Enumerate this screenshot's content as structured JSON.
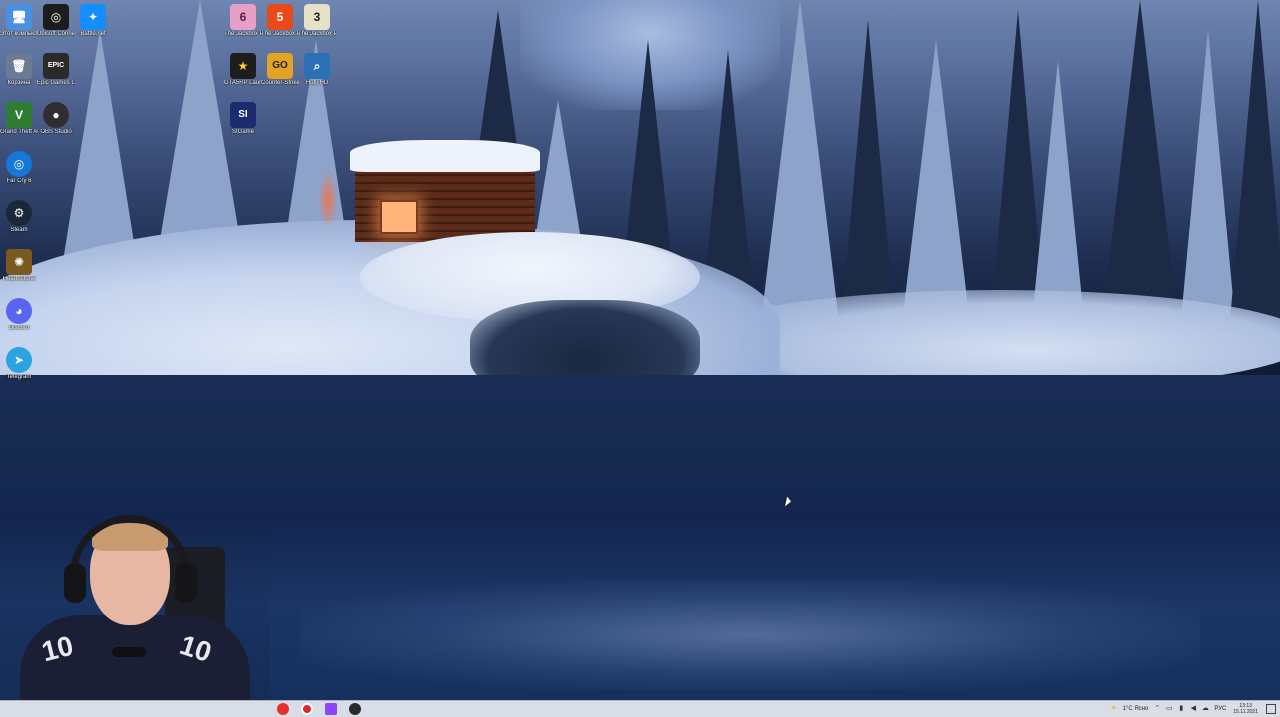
{
  "desktop": {
    "icons": [
      {
        "name": "this-pc",
        "label": "Этот компьютер",
        "glyph": "🖥",
        "color": "#4a90e2"
      },
      {
        "name": "ubisoft-connect",
        "label": "Ubisoft Connect",
        "glyph": "◎",
        "color": "#1c1c1c"
      },
      {
        "name": "battle-net",
        "label": "Battle.net",
        "glyph": "✦",
        "color": "#148eff"
      },
      {
        "name": "recycle-bin",
        "label": "Корзина",
        "glyph": "🗑",
        "color": "#6c7a94"
      },
      {
        "name": "epic-games",
        "label": "Epic Games Launcher",
        "glyph": "EPIC",
        "color": "#2a2a2a"
      },
      {
        "name": "gta-v",
        "label": "Grand Theft Auto V",
        "glyph": "V",
        "color": "#2f7d32"
      },
      {
        "name": "obs-studio",
        "label": "OBS Studio",
        "glyph": "●",
        "color": "#302e31"
      },
      {
        "name": "far-cry-6",
        "label": "Far Cry 6",
        "glyph": "◎",
        "color": "#1777d6"
      },
      {
        "name": "steam",
        "label": "Steam",
        "glyph": "⚙",
        "color": "#1b2838"
      },
      {
        "name": "hearthstone",
        "label": "Hearthstone",
        "glyph": "✺",
        "color": "#7a5a1f"
      },
      {
        "name": "discord",
        "label": "Discord",
        "glyph": "◕",
        "color": "#5865f2"
      },
      {
        "name": "telegram",
        "label": "Telegram",
        "glyph": "➤",
        "color": "#2aa3df"
      },
      {
        "name": "jackbox-6",
        "label": "The Jackbox Party Pack 6",
        "glyph": "6",
        "color": "#e6a0c8"
      },
      {
        "name": "jackbox-5",
        "label": "The Jackbox Party Pack 5",
        "glyph": "5",
        "color": "#e84a1a"
      },
      {
        "name": "jackbox-3",
        "label": "The Jackbox Party Pack 3",
        "glyph": "3",
        "color": "#e7e0c8"
      },
      {
        "name": "gta5rp",
        "label": "GTA5RP Launcher",
        "glyph": "★",
        "color": "#1d1d1d"
      },
      {
        "name": "csgo",
        "label": "Counter-Strike: Global Offensive",
        "glyph": "GO",
        "color": "#e3a324"
      },
      {
        "name": "hotline",
        "label": "Hotli HD",
        "glyph": "⌕",
        "color": "#2b6fb4"
      },
      {
        "name": "sigame",
        "label": "SIGame",
        "glyph": "SI",
        "color": "#1b2b70"
      }
    ]
  },
  "webcam": {
    "jersey_number": "10"
  },
  "taskbar": {
    "apps": [
      {
        "name": "yandex-browser",
        "color": "#e62e2e"
      },
      {
        "name": "opera",
        "color": "#e0242e"
      },
      {
        "name": "twitch",
        "color": "#8b45ff"
      },
      {
        "name": "obs",
        "color": "#2b2b2b"
      }
    ],
    "weather": "1°C Ясно",
    "language": "РУС",
    "time": "13:13",
    "date": "15.11.2021"
  }
}
